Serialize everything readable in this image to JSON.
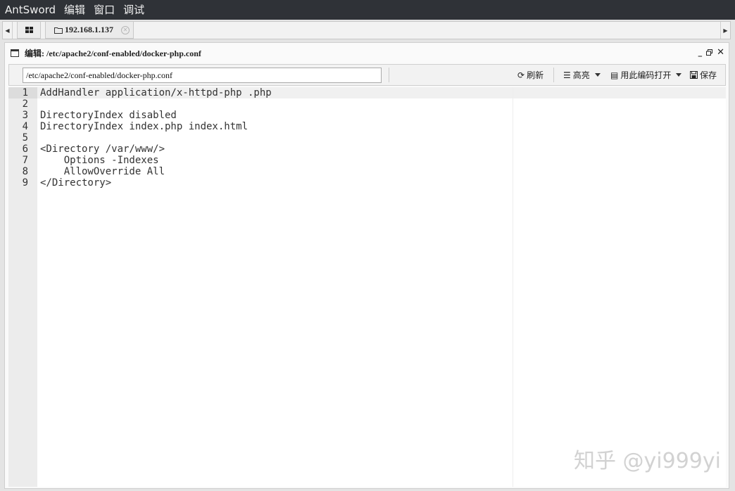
{
  "menubar": {
    "items": [
      {
        "label": "AntSword"
      },
      {
        "label": "编辑"
      },
      {
        "label": "窗口"
      },
      {
        "label": "调试"
      }
    ]
  },
  "tabs": {
    "active_label": "192.168.1.137"
  },
  "window": {
    "title": "编辑: /etc/apache2/conf-enabled/docker-php.conf"
  },
  "toolbar": {
    "path_value": "/etc/apache2/conf-enabled/docker-php.conf",
    "refresh_label": "刷新",
    "highlight_label": "高亮",
    "open_with_encoding_label": "用此编码打开",
    "save_label": "保存"
  },
  "editor": {
    "lines": [
      {
        "num": "1",
        "text": "AddHandler application/x-httpd-php .php"
      },
      {
        "num": "2",
        "text": ""
      },
      {
        "num": "3",
        "text": "DirectoryIndex disabled"
      },
      {
        "num": "4",
        "text": "DirectoryIndex index.php index.html"
      },
      {
        "num": "5",
        "text": ""
      },
      {
        "num": "6",
        "text": "<Directory /var/www/>"
      },
      {
        "num": "7",
        "text": "    Options -Indexes"
      },
      {
        "num": "8",
        "text": "    AllowOverride All"
      },
      {
        "num": "9",
        "text": "</Directory>"
      }
    ]
  },
  "watermark": {
    "text": "知乎 @yi999yi"
  }
}
